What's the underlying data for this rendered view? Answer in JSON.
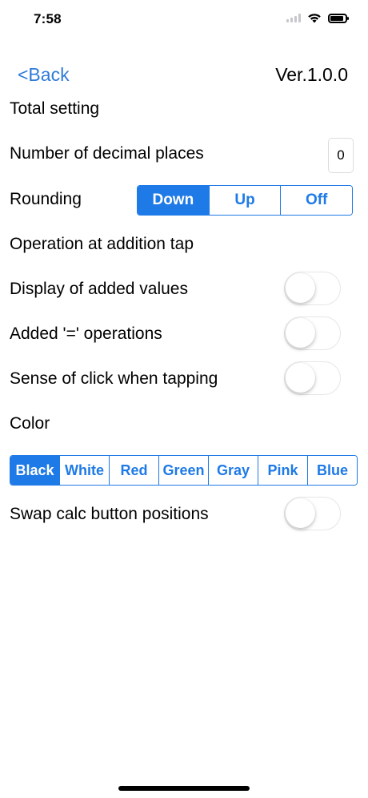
{
  "status_bar": {
    "time": "7:58",
    "battery_level": 0.9
  },
  "nav": {
    "back_label": "<Back",
    "version": "Ver.1.0.0"
  },
  "sections": {
    "total_setting": "Total setting",
    "decimal_places_label": "Number of decimal places",
    "decimal_places_value": "0",
    "rounding_label": "Rounding",
    "rounding_options": [
      "Down",
      "Up",
      "Off"
    ],
    "rounding_selected": "Down",
    "operation_label": "Operation at addition tap",
    "display_added_label": "Display of added values",
    "display_added_on": false,
    "added_equals_label": "Added '=' operations",
    "added_equals_on": false,
    "click_sense_label": "Sense of click when tapping",
    "click_sense_on": false,
    "color_label": "Color",
    "color_options": [
      "Black",
      "White",
      "Red",
      "Green",
      "Gray",
      "Pink",
      "Blue"
    ],
    "color_selected": "Black",
    "swap_label": "Swap calc button positions",
    "swap_on": false
  },
  "colors": {
    "accent": "#1e7ae6",
    "link": "#2f7bd9"
  }
}
